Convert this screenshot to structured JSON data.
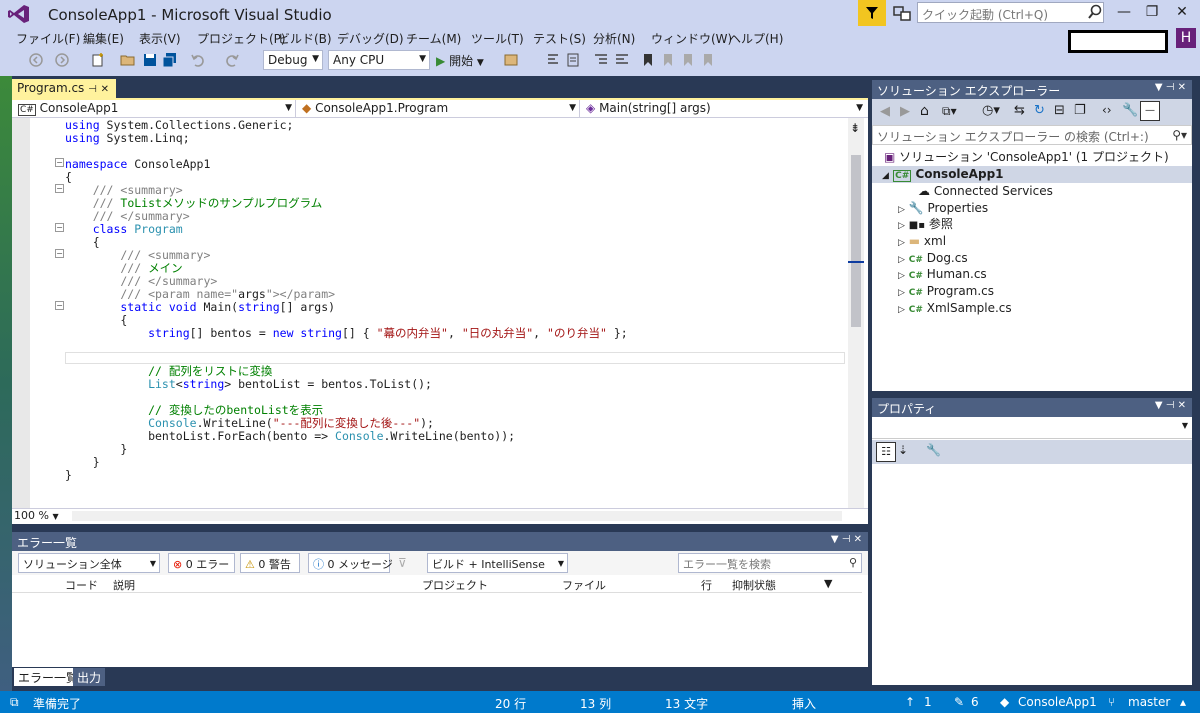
{
  "window": {
    "title": "ConsoleApp1 - Microsoft Visual Studio",
    "quick_launch_placeholder": "クイック起動 (Ctrl+Q)",
    "avatar_letter": "H"
  },
  "menu": [
    "ファイル(F)",
    "編集(E)",
    "表示(V)",
    "プロジェクト(P)",
    "ビルド(B)",
    "デバッグ(D)",
    "チーム(M)",
    "ツール(T)",
    "テスト(S)",
    "分析(N)",
    "ウィンドウ(W)",
    "ヘルプ(H)"
  ],
  "toolbar": {
    "config": "Debug",
    "platform": "Any CPU",
    "start_label": "開始"
  },
  "editor": {
    "tab_label": "Program.cs",
    "nav_project": "ConsoleApp1",
    "nav_class": "ConsoleApp1.Program",
    "nav_member": "Main(string[] args)",
    "zoom": "100 %",
    "lines": {
      "l1a": "using",
      "l1b": " System.Collections.Generic;",
      "l2a": "using",
      "l2b": " System.Linq;",
      "l3a": "namespace",
      "l3b": " ConsoleApp1",
      "l4": "{",
      "l5a": "    ///",
      "l5b": " <summary>",
      "l6a": "    ///",
      "l6b": " ToListメソッドのサンプルプログラム",
      "l7a": "    ///",
      "l7b": " </summary>",
      "l8a": "    class",
      "l8b": " Program",
      "l9": "    {",
      "l10a": "        ///",
      "l10b": " <summary>",
      "l11a": "        ///",
      "l11b": " メイン",
      "l12a": "        ///",
      "l12b": " </summary>",
      "l13a": "        ///",
      "l13b": " <param name=\"",
      "l13c": "args",
      "l13d": "\"></param>",
      "l14a": "        static",
      "l14b": " void",
      "l14c": " Main(",
      "l14d": "string",
      "l14e": "[] args)",
      "l15": "        {",
      "l16a": "            string",
      "l16b": "[] bentos = ",
      "l16c": "new",
      "l16d": " string",
      "l16e": "[] { ",
      "l16f": "\"幕の内弁当\"",
      "l16g": ", ",
      "l16h": "\"日の丸弁当\"",
      "l16i": ", ",
      "l16j": "\"のり弁当\"",
      "l16k": " };",
      "l17": "            // 配列をリストに変換",
      "l18a": "            List",
      "l18b": "<",
      "l18c": "string",
      "l18d": "> bentoList = bentos.ToList();",
      "l19": "            // 変換したのbentoListを表示",
      "l20a": "            Console",
      "l20b": ".WriteLine(",
      "l20c": "\"---配列に変換した後---\"",
      "l20d": ");",
      "l21a": "            bentoList.ForEach(bento => ",
      "l21b": "Console",
      "l21c": ".WriteLine(bento));",
      "l22": "        }",
      "l23": "    }",
      "l24": "}"
    }
  },
  "error_list": {
    "title": "エラー一覧",
    "scope": "ソリューション全体",
    "errors": "0 エラー",
    "warnings": "0 警告",
    "messages": "0 メッセージ",
    "build_filter": "ビルド + IntelliSense",
    "search_placeholder": "エラー一覧を検索",
    "columns": [
      "コード",
      "説明",
      "プロジェクト",
      "ファイル",
      "行",
      "抑制状態"
    ],
    "tabs": [
      "エラー一覧",
      "出力"
    ]
  },
  "solution_explorer": {
    "title": "ソリューション エクスプローラー",
    "search_placeholder": "ソリューション エクスプローラー の検索 (Ctrl+:)",
    "solution": "ソリューション 'ConsoleApp1' (1 プロジェクト)",
    "project": "ConsoleApp1",
    "items": [
      "Connected Services",
      "Properties",
      "参照",
      "xml",
      "Dog.cs",
      "Human.cs",
      "Program.cs",
      "XmlSample.cs"
    ]
  },
  "properties": {
    "title": "プロパティ"
  },
  "status": {
    "ready": "準備完了",
    "line": "20 行",
    "col": "13 列",
    "char": "13 文字",
    "mode": "挿入",
    "push": "1",
    "edits": "6",
    "repo": "ConsoleApp1",
    "branch": "master"
  }
}
